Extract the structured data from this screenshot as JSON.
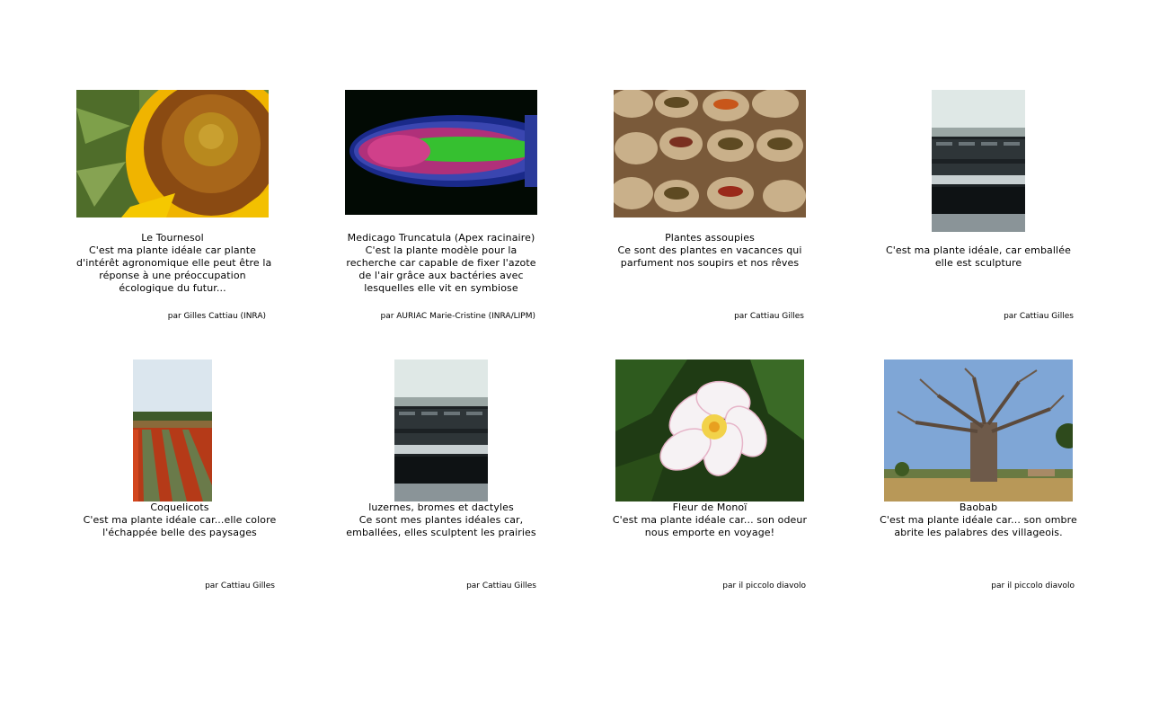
{
  "gallery": [
    {
      "title": "Le Tournesol",
      "lines": [
        "C'est ma plante idéale car plante",
        "d'intérêt agronomique elle peut être la",
        "réponse à une préoccupation",
        "écologique du futur..."
      ],
      "author": "par Gilles Cattiau (INRA)",
      "image": "sunflower-photo"
    },
    {
      "title": "Medicago Truncatula (Apex racinaire)",
      "lines": [
        "C'est la plante modèle pour la",
        "recherche car capable de fixer l'azote",
        "de l'air grâce aux bactéries avec",
        "lesquelles elle vit en symbiose"
      ],
      "author": "par AURIAC Marie-Cristine (INRA/LIPM)",
      "image": "root-apex-microscopy-photo"
    },
    {
      "title": "Plantes assoupies",
      "lines": [
        "Ce sont des plantes en vacances qui",
        "parfument nos soupirs et nos rêves"
      ],
      "author": "par Cattiau Gilles",
      "image": "spice-sacks-photo"
    },
    {
      "title": "",
      "lines": [
        "C'est ma plante idéale, car emballée",
        "elle est sculpture"
      ],
      "author": "par Cattiau Gilles",
      "image": "wrapped-bales-photo"
    },
    {
      "title": "Coquelicots",
      "lines": [
        "C'est ma plante idéale car...elle colore",
        "l'échappée belle des paysages"
      ],
      "author": "par Cattiau Gilles",
      "image": "poppy-field-photo"
    },
    {
      "title": "luzernes, bromes et dactyles",
      "lines": [
        "Ce sont mes plantes idéales car,",
        "emballées, elles sculptent les prairies"
      ],
      "author": "par Cattiau Gilles",
      "image": "wrapped-bales-photo"
    },
    {
      "title": "Fleur de Monoï",
      "lines": [
        "C'est ma plante idéale car... son odeur",
        "nous emporte en voyage!"
      ],
      "author": "par il piccolo diavolo",
      "image": "frangipani-flower-photo"
    },
    {
      "title": "Baobab",
      "lines": [
        "C'est ma plante idéale car... son ombre",
        "abrite les palabres des villageois."
      ],
      "author": "par il piccolo diavolo",
      "image": "baobab-tree-photo"
    }
  ]
}
